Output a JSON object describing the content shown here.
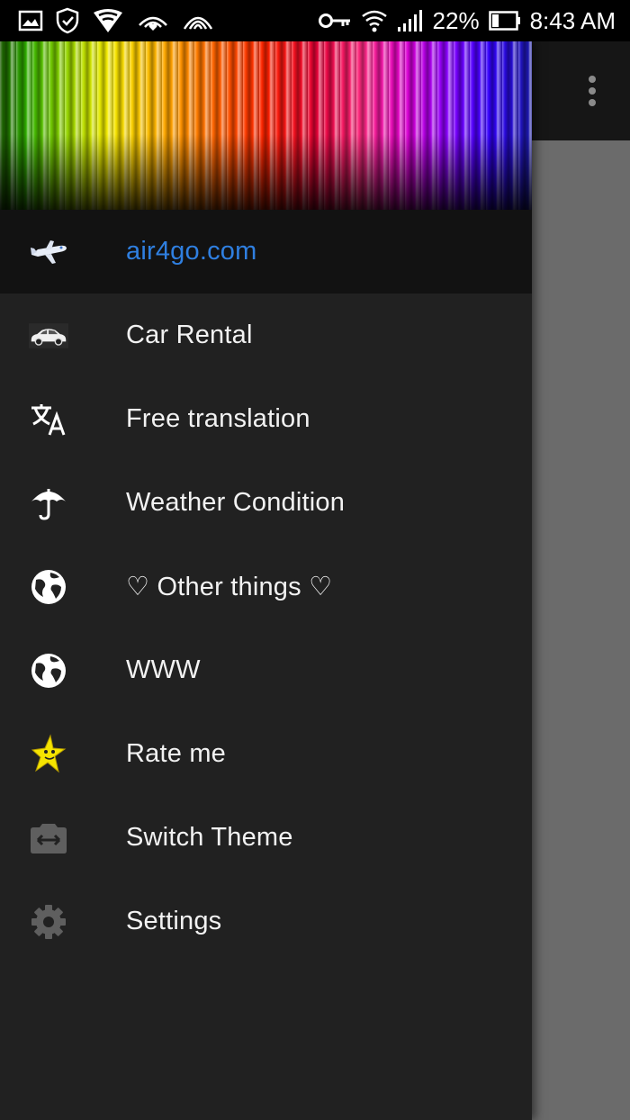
{
  "status_bar": {
    "battery_percent": "22%",
    "time": "8:43 AM"
  },
  "drawer": {
    "items": [
      {
        "label": "air4go.com",
        "icon": "airplane-icon",
        "active": true
      },
      {
        "label": "Car Rental",
        "icon": "car-icon"
      },
      {
        "label": "Free translation",
        "icon": "translate-icon"
      },
      {
        "label": "Weather Condition",
        "icon": "umbrella-icon"
      },
      {
        "label": "♡ Other things ♡",
        "icon": "globe-icon"
      },
      {
        "label": "WWW",
        "icon": "globe-icon"
      },
      {
        "label": "Rate me",
        "icon": "star-icon"
      },
      {
        "label": "Switch Theme",
        "icon": "switch-camera-icon"
      },
      {
        "label": "Settings",
        "icon": "gear-icon"
      }
    ]
  },
  "colors": {
    "drawer_bg": "#212121",
    "active_bg": "#121212",
    "active_text": "#2f7fe0",
    "text": "#f2f2f2",
    "scrim": "#6b6b6b"
  }
}
